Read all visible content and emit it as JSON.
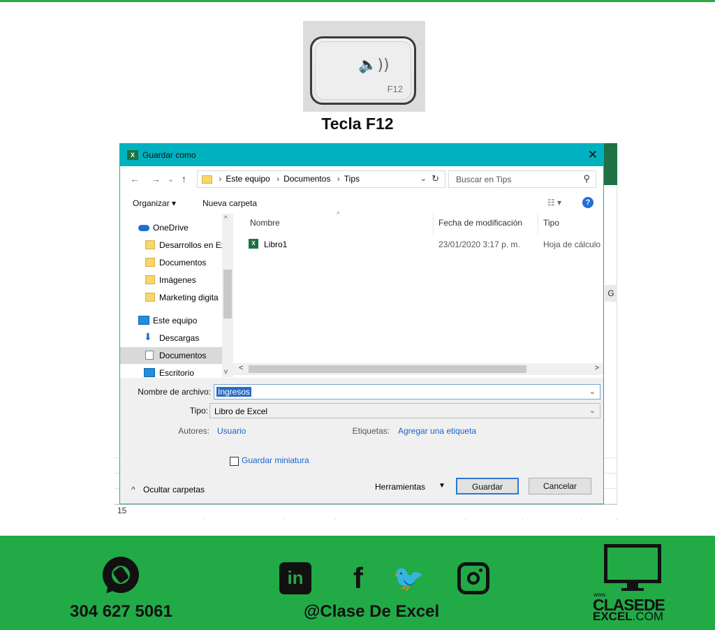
{
  "key": {
    "label": "F12",
    "symbol": "🔈))"
  },
  "caption": "Tecla F12",
  "excel": {
    "row_number": "15",
    "col_letter": "G"
  },
  "dialog": {
    "title": "Guardar como",
    "nav": {
      "back": "←",
      "forward": "→",
      "recent": "⌄",
      "up": "↑"
    },
    "breadcrumb": [
      "Este equipo",
      "Documentos",
      "Tips"
    ],
    "search_placeholder": "Buscar en Tips",
    "toolbar": {
      "organize": "Organizar ▾",
      "new_folder": "Nueva carpeta"
    },
    "nav_items": [
      {
        "label": "OneDrive",
        "icon": "cloud-icon"
      },
      {
        "label": "Desarrollos en Ex",
        "icon": "folder-icon"
      },
      {
        "label": "Documentos",
        "icon": "folder-icon"
      },
      {
        "label": "Imágenes",
        "icon": "folder-icon"
      },
      {
        "label": "Marketing digita",
        "icon": "folder-icon"
      },
      {
        "label": "Este equipo",
        "icon": "computer-icon"
      },
      {
        "label": "Descargas",
        "icon": "download-icon"
      },
      {
        "label": "Documentos",
        "icon": "document-icon"
      },
      {
        "label": "Escritorio",
        "icon": "desktop-icon"
      }
    ],
    "columns": [
      "Nombre",
      "Fecha de modificación",
      "Tipo"
    ],
    "files": [
      {
        "name": "Libro1",
        "date": "23/01/2020 3:17 p. m.",
        "type": "Hoja de cálculo"
      }
    ],
    "filename_label": "Nombre de archivo:",
    "filename_value": "Ingresos",
    "type_label": "Tipo:",
    "type_value": "Libro de Excel",
    "authors_label": "Autores:",
    "authors_value": "Usuario",
    "tags_label": "Etiquetas:",
    "tags_value": "Agregar una etiqueta",
    "thumbnail_label": "Guardar miniatura",
    "hide_folders": "Ocultar carpetas",
    "tools": "Herramientas",
    "save": "Guardar",
    "cancel": "Cancelar"
  },
  "footer": {
    "phone": "304 627 5061",
    "handle": "@Clase De Excel",
    "brand_www": "www.",
    "brand_line1": "CLASEDE",
    "brand_line2_bold": "EXCEL",
    "brand_line2_rest": ".COM",
    "social": [
      "linkedin-icon",
      "facebook-icon",
      "twitter-icon",
      "instagram-icon"
    ]
  }
}
